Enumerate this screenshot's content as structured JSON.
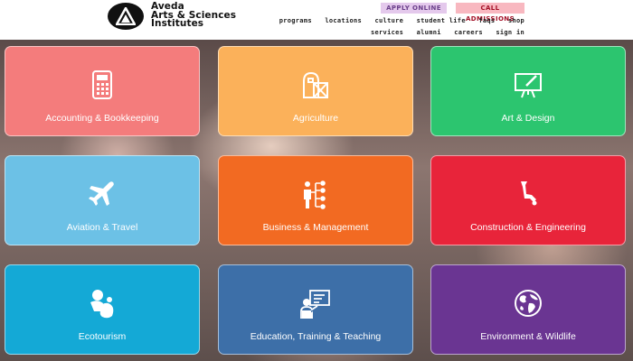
{
  "header": {
    "logo_lines": [
      "Aveda",
      "Arts & Sciences",
      "Institutes"
    ],
    "apply_label": "APPLY ONLINE",
    "call_label": "CALL ADMISSIONS",
    "nav_primary": [
      "programs",
      "locations",
      "culture",
      "student life",
      "faqs",
      "shop"
    ],
    "nav_secondary": [
      "services",
      "alumni",
      "careers",
      "sign in"
    ]
  },
  "tiles": [
    {
      "label": "Accounting & Bookkeeping",
      "color": "#f47c7c",
      "icon": "calculator-icon"
    },
    {
      "label": "Agriculture",
      "color": "#fbb15a",
      "icon": "barn-icon"
    },
    {
      "label": "Art & Design",
      "color": "#2cc56f",
      "icon": "easel-icon"
    },
    {
      "label": "Aviation & Travel",
      "color": "#6cc1e6",
      "icon": "airplane-icon"
    },
    {
      "label": "Business & Management",
      "color": "#f26a22",
      "icon": "org-chart-icon"
    },
    {
      "label": "Construction & Engineering",
      "color": "#e8243a",
      "icon": "crane-icon"
    },
    {
      "label": "Ecotourism",
      "color": "#14a9d6",
      "icon": "travelers-icon"
    },
    {
      "label": "Education, Training & Teaching",
      "color": "#3d6fa8",
      "icon": "teacher-icon"
    },
    {
      "label": "Environment & Wildlife",
      "color": "#6a3592",
      "icon": "globe-icon"
    }
  ]
}
